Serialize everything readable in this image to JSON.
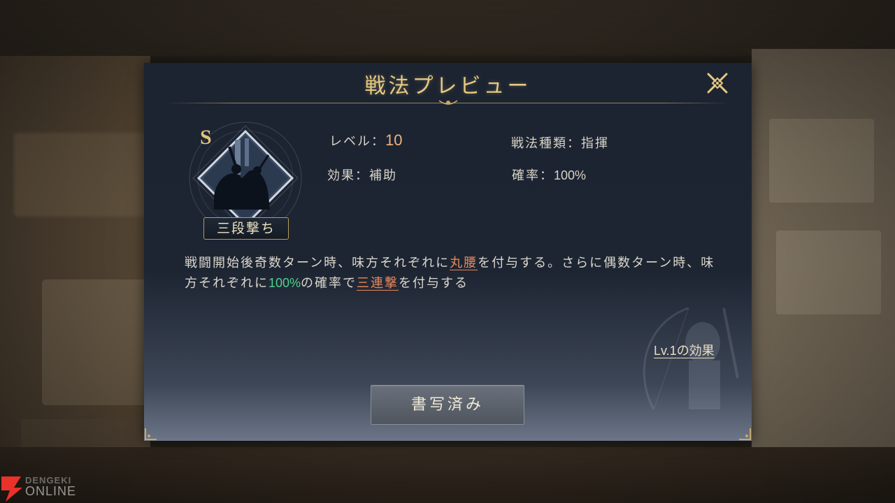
{
  "dialog": {
    "title": "戦法プレビュー",
    "close_icon": "close-icon"
  },
  "skill": {
    "rank": "S",
    "name": "三段撃ち",
    "level_label": "レベル：",
    "level_value": "10",
    "effect_label": "効果：",
    "effect_value": "補助",
    "type_label": "戦法種類：",
    "type_value": "指揮",
    "rate_label": "確率：",
    "rate_value": "100%"
  },
  "description": {
    "part1": "戦闘開始後奇数ターン時、味方それぞれに",
    "keyword1": "丸腰",
    "part2": "を付与する。さらに偶数ターン時、味方それぞれに",
    "percent": "100%",
    "part3": "の確率で",
    "keyword2": "三連撃",
    "part4": "を付与する"
  },
  "links": {
    "lv1_prefix": "Lv.1",
    "lv1_suffix": "の効果"
  },
  "actions": {
    "copied_label": "書写済み"
  },
  "watermark": {
    "line1": "DENGEKI",
    "line2": "ONLINE"
  },
  "colors": {
    "title_gold": "#e6c981",
    "keyword_orange": "#e8875a",
    "percent_green": "#4fd08a"
  }
}
